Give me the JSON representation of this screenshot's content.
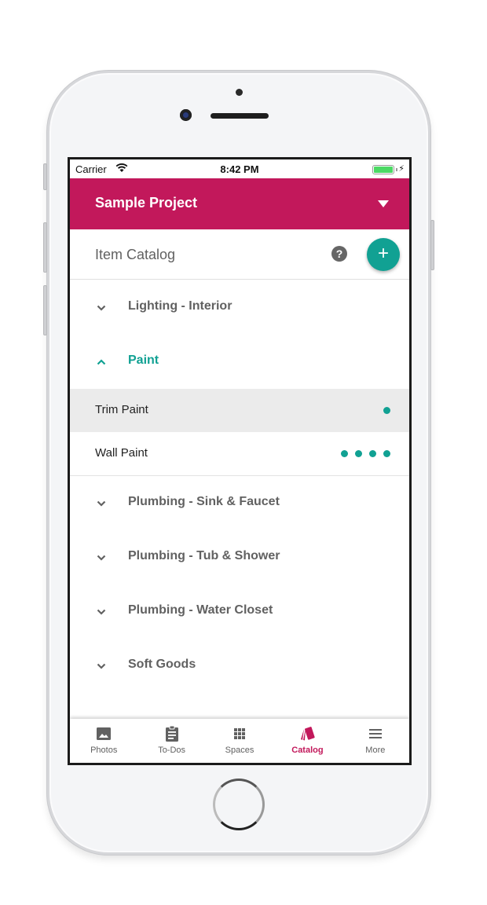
{
  "status_bar": {
    "carrier": "Carrier",
    "time": "8:42 PM",
    "battery_percent": 100,
    "charging_icon": "⚡"
  },
  "app_bar": {
    "project_title": "Sample Project",
    "dropdown_icon": "caret-down-icon"
  },
  "sub_header": {
    "title": "Item Catalog",
    "help_icon": "?",
    "add_icon": "+"
  },
  "catalog": {
    "groups": [
      {
        "label": "Lighting - Interior",
        "expanded": false
      },
      {
        "label": "Paint",
        "expanded": true,
        "items": [
          {
            "label": "Trim Paint",
            "count": 1,
            "selected": true
          },
          {
            "label": "Wall Paint",
            "count": 4,
            "selected": false
          }
        ]
      },
      {
        "label": "Plumbing - Sink & Faucet",
        "expanded": false
      },
      {
        "label": "Plumbing - Tub & Shower",
        "expanded": false
      },
      {
        "label": "Plumbing - Water Closet",
        "expanded": false
      },
      {
        "label": "Soft Goods",
        "expanded": false
      }
    ]
  },
  "tab_bar": {
    "tabs": [
      {
        "label": "Photos",
        "icon": "photo-icon",
        "active": false
      },
      {
        "label": "To-Dos",
        "icon": "clipboard-icon",
        "active": false
      },
      {
        "label": "Spaces",
        "icon": "grid-icon",
        "active": false
      },
      {
        "label": "Catalog",
        "icon": "swatch-icon",
        "active": true
      },
      {
        "label": "More",
        "icon": "menu-icon",
        "active": false
      }
    ]
  },
  "colors": {
    "primary": "#c2185b",
    "accent": "#11a193",
    "text_muted": "#616161",
    "selected_row": "#ebebeb"
  }
}
